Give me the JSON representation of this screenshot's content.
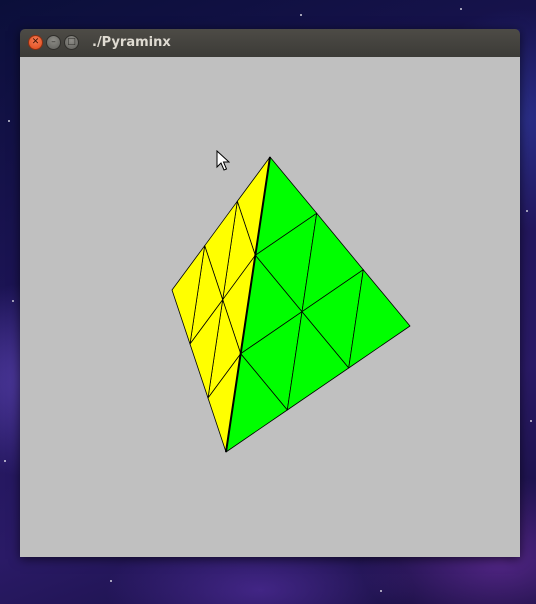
{
  "window": {
    "title": "./Pyraminx",
    "buttons": {
      "close_icon": "close-icon",
      "minimize_icon": "minimize-icon",
      "maximize_icon": "maximize-icon"
    }
  },
  "canvas": {
    "background": "#c0c0c0"
  },
  "pyraminx": {
    "faces": [
      {
        "name": "left-face",
        "color": "#ffff00"
      },
      {
        "name": "right-face",
        "color": "#00ff00"
      }
    ],
    "edge_color": "#000000"
  },
  "cursor": {
    "icon": "arrow-pointer-icon"
  }
}
